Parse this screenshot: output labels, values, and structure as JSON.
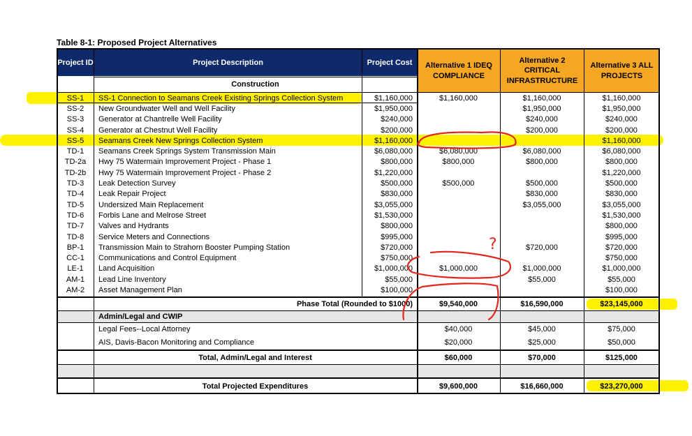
{
  "table_title": "Table 8-1: Proposed Project Alternatives",
  "headers": {
    "project_id": "Project ID",
    "project_description": "Project Description",
    "project_cost": "Project Cost",
    "alt1": "Alternative 1 IDEQ COMPLIANCE",
    "alt2": "Alternative 2 CRITICAL INFRASTRUCTURE",
    "alt3": "Alternative 3 ALL PROJECTS"
  },
  "section_construction": "Construction",
  "rows": [
    {
      "id": "SS-1",
      "desc": "SS-1 Connection to Seamans Creek Existing Springs Collection System",
      "cost": "$1,160,000",
      "a1": "$1,160,000",
      "a2": "$1,160,000",
      "a3": "$1,160,000"
    },
    {
      "id": "SS-2",
      "desc": "New Groundwater Well and Well Facility",
      "cost": "$1,950,000",
      "a1": "",
      "a2": "$1,950,000",
      "a3": "$1,950,000"
    },
    {
      "id": "SS-3",
      "desc": "Generator at Chantrelle Well Facility",
      "cost": "$240,000",
      "a1": "",
      "a2": "$240,000",
      "a3": "$240,000"
    },
    {
      "id": "SS-4",
      "desc": "Generator at Chestnut Well Facility",
      "cost": "$200,000",
      "a1": "",
      "a2": "$200,000",
      "a3": "$200,000"
    },
    {
      "id": "SS-5",
      "desc": "Seamans Creek New Springs Collection System",
      "cost": "$1,160,000",
      "a1": "",
      "a2": "",
      "a3": "$1,160,000"
    },
    {
      "id": "TD-1",
      "desc": "Seamans Creek Springs System Transmission Main",
      "cost": "$6,080,000",
      "a1": "$6,080,000",
      "a2": "$6,080,000",
      "a3": "$6,080,000"
    },
    {
      "id": "TD-2a",
      "desc": "Hwy 75 Watermain Improvement Project - Phase 1",
      "cost": "$800,000",
      "a1": "$800,000",
      "a2": "$800,000",
      "a3": "$800,000"
    },
    {
      "id": "TD-2b",
      "desc": "Hwy 75 Watermain Improvement Project - Phase 2",
      "cost": "$1,220,000",
      "a1": "",
      "a2": "",
      "a3": "$1,220,000"
    },
    {
      "id": "TD-3",
      "desc": "Leak Detection Survey",
      "cost": "$500,000",
      "a1": "$500,000",
      "a2": "$500,000",
      "a3": "$500,000"
    },
    {
      "id": "TD-4",
      "desc": "Leak Repair Project",
      "cost": "$830,000",
      "a1": "",
      "a2": "$830,000",
      "a3": "$830,000"
    },
    {
      "id": "TD-5",
      "desc": "Undersized Main Replacement",
      "cost": "$3,055,000",
      "a1": "",
      "a2": "$3,055,000",
      "a3": "$3,055,000"
    },
    {
      "id": "TD-6",
      "desc": "Forbis Lane and Melrose Street",
      "cost": "$1,530,000",
      "a1": "",
      "a2": "",
      "a3": "$1,530,000"
    },
    {
      "id": "TD-7",
      "desc": "Valves and Hydrants",
      "cost": "$800,000",
      "a1": "",
      "a2": "",
      "a3": "$800,000"
    },
    {
      "id": "TD-8",
      "desc": "Service Meters and Connections",
      "cost": "$995,000",
      "a1": "",
      "a2": "",
      "a3": "$995,000"
    },
    {
      "id": "BP-1",
      "desc": "Transmission Main to Strahorn Booster Pumping Station",
      "cost": "$720,000",
      "a1": "",
      "a2": "$720,000",
      "a3": "$720,000"
    },
    {
      "id": "CC-1",
      "desc": "Communications and Control Equipment",
      "cost": "$750,000",
      "a1": "",
      "a2": "",
      "a3": "$750,000"
    },
    {
      "id": "LE-1",
      "desc": "Land Acquisition",
      "cost": "$1,000,000",
      "a1": "$1,000,000",
      "a2": "$1,000,000",
      "a3": "$1,000,000"
    },
    {
      "id": "AM-1",
      "desc": "Lead Line Inventory",
      "cost": "$55,000",
      "a1": "",
      "a2": "$55,000",
      "a3": "$55,000"
    },
    {
      "id": "AM-2",
      "desc": "Asset Management Plan",
      "cost": "$100,000",
      "a1": "",
      "a2": "",
      "a3": "$100,000"
    }
  ],
  "phase_total": {
    "label": "Phase Total (Rounded to $1000)",
    "a1": "$9,540,000",
    "a2": "$16,590,000",
    "a3": "$23,145,000"
  },
  "section_admin": "Admin/Legal and CWIP",
  "admin_rows": [
    {
      "desc": "Legal Fees--Local Attorney",
      "a1": "$40,000",
      "a2": "$45,000",
      "a3": "$75,000"
    },
    {
      "desc": "AIS, Davis-Bacon Monitoring and Compliance",
      "a1": "$20,000",
      "a2": "$25,000",
      "a3": "$50,000"
    }
  ],
  "admin_total": {
    "label": "Total, Admin/Legal and Interest",
    "a1": "$60,000",
    "a2": "$70,000",
    "a3": "$125,000"
  },
  "grand_total": {
    "label": "Total Projected Expenditures",
    "a1": "$9,600,000",
    "a2": "$16,660,000",
    "a3": "$23,270,000"
  },
  "annotation_mark": "?",
  "colors": {
    "navy": "#0f2a6b",
    "orange": "#f5a623",
    "highlight": "#fff200",
    "ink": "#e3261d",
    "grey": "#e6e6e6"
  }
}
